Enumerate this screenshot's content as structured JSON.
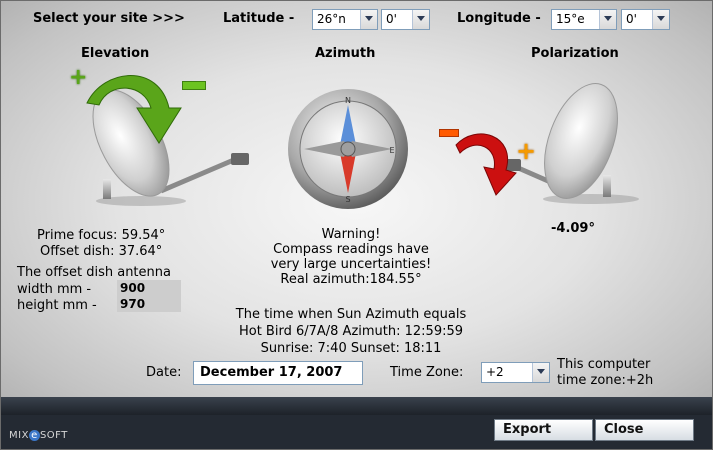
{
  "site": {
    "prompt": "Select your site >>>",
    "latitude_label": "Latitude -",
    "latitude_deg": "26°n",
    "latitude_min": "0'",
    "longitude_label": "Longitude -",
    "longitude_deg": "15°e",
    "longitude_min": "0'"
  },
  "sections": {
    "elevation": "Elevation",
    "azimuth": "Azimuth",
    "polarization": "Polarization"
  },
  "elevation": {
    "prime_focus": "Prime focus: 59.54°",
    "offset_dish": "Offset dish: 37.64°",
    "plus": "+",
    "minus": "−"
  },
  "compass": {
    "n": "N",
    "e": "E",
    "s": "S"
  },
  "azimuth": {
    "warning_1": "Warning!",
    "warning_2": "Compass readings have",
    "warning_3": "very large uncertainties!",
    "real": "Real azimuth:184.55°"
  },
  "polarization": {
    "value": "-4.09°",
    "plus": "+",
    "minus": "−"
  },
  "antenna": {
    "title": "The offset dish antenna",
    "width_label": "width  mm -",
    "width_value": "900",
    "height_label": "height mm -",
    "height_value": "970"
  },
  "sun": {
    "line1": "The time when Sun Azimuth equals",
    "line2": "Hot Bird 6/7A/8 Azimuth: 12:59:59",
    "line3": "Sunrise: 7:40   Sunset: 18:11"
  },
  "date": {
    "label": "Date:",
    "value": "December 17, 2007"
  },
  "timezone": {
    "label": "Time Zone:",
    "value": "+2",
    "note_1": "This computer",
    "note_2": "time zone:+2h"
  },
  "footer": {
    "brand_left": "MIX",
    "brand_e": "e",
    "brand_right": "SOFT",
    "export": "Export",
    "close": "Close"
  },
  "colors": {
    "accent_green": "#5aa51a",
    "accent_red": "#cc1010",
    "plus_orange": "#f59a00"
  }
}
